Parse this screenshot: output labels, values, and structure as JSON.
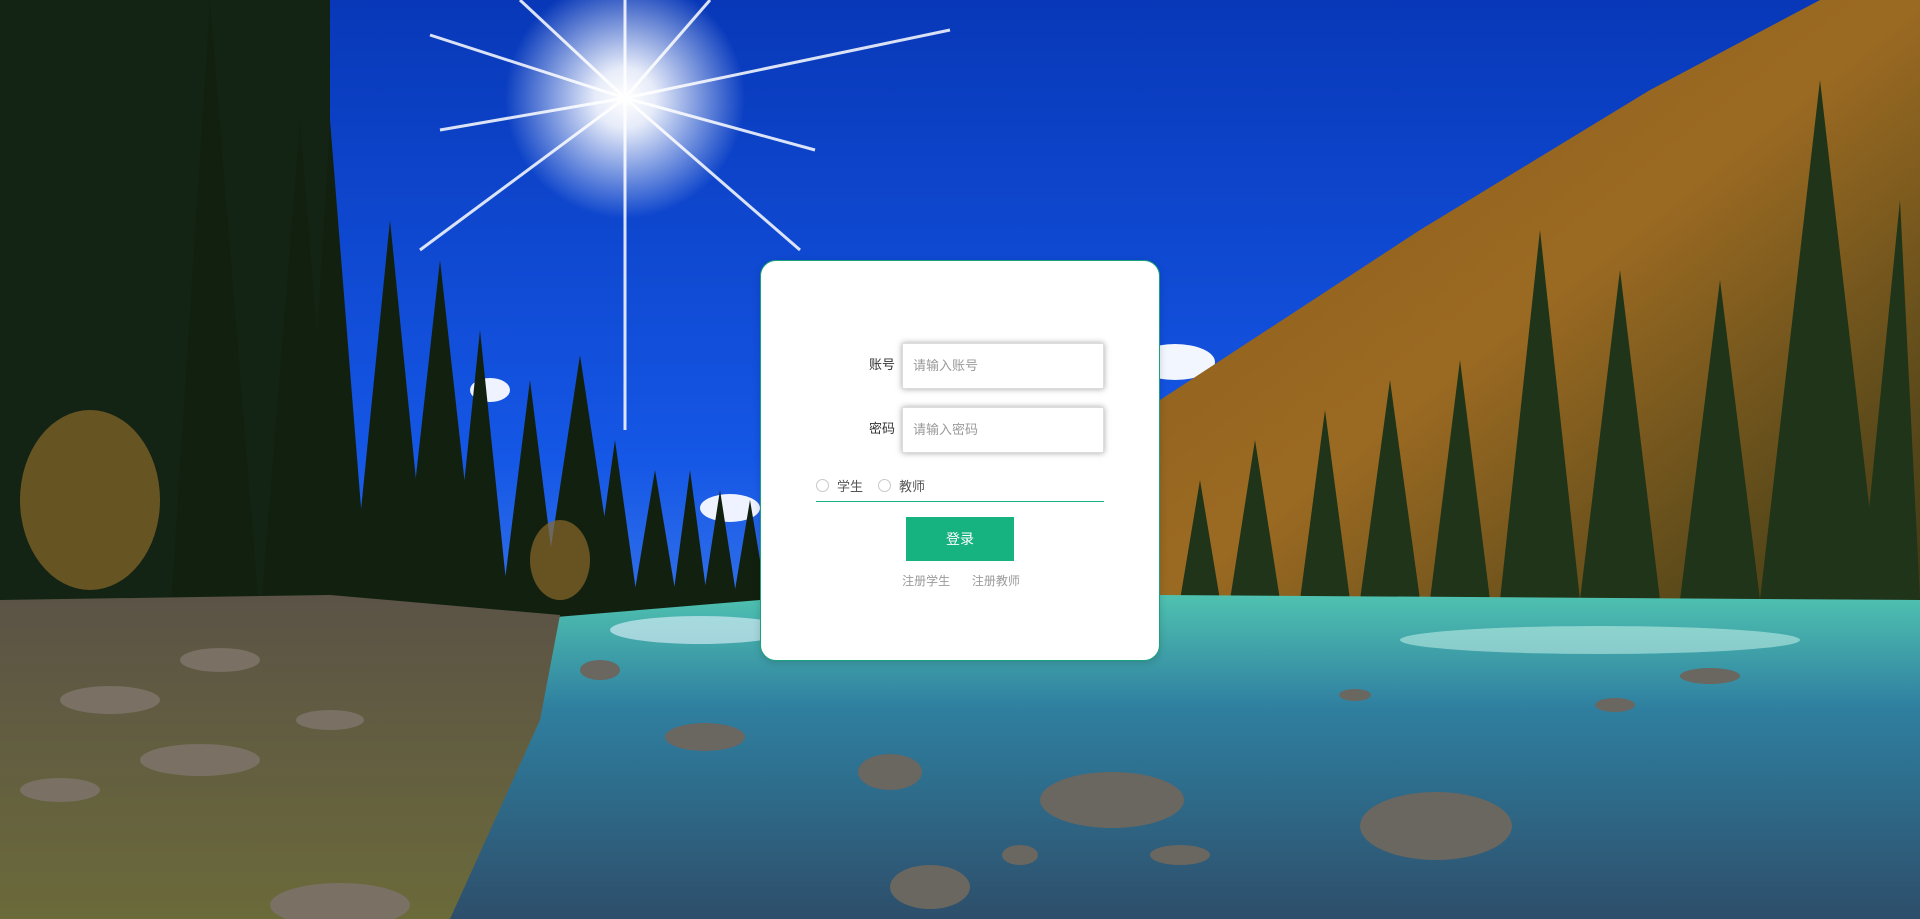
{
  "background": {
    "description_icon": "landscape-river-forest-sun",
    "sky_color": "#0a3fd4",
    "water_color": "#3fb8a8"
  },
  "login": {
    "account_label": "账号",
    "account_placeholder": "请输入账号",
    "password_label": "密码",
    "password_placeholder": "请输入密码",
    "roles": [
      {
        "label": "学生"
      },
      {
        "label": "教师"
      }
    ],
    "submit_label": "登录",
    "register_student": "注册学生",
    "register_teacher": "注册教师",
    "accent_color": "#16b27f"
  }
}
